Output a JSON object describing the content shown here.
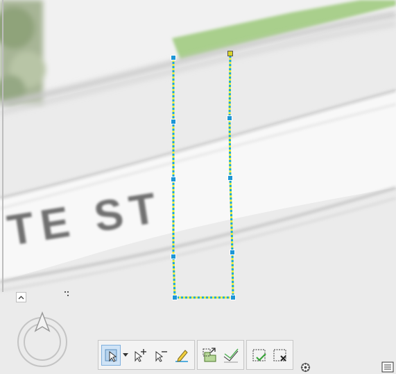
{
  "map": {
    "street_label": "TE ST",
    "colors": {
      "road": "#f6f6f6",
      "ground": "#e9e9e9",
      "grass": "#9cc77b",
      "sketch_line": "#e8ef3a",
      "sketch_dash": "#19a6d6",
      "vertex": "#1f96d6",
      "vertex_selected": "#d8d22a"
    }
  },
  "controls": {
    "collapse_icon": "chevron-up-icon",
    "grip_icon": "grip-icon",
    "navigator_icon": "compass-navigator-icon",
    "settings_icon": "gear-icon",
    "panel_icon": "attribute-panel-icon"
  },
  "editing_toolbar": {
    "groups": [
      {
        "name": "selection",
        "tools": [
          "select-vertex-icon",
          "dropdown-arrow-icon",
          "add-vertex-icon",
          "remove-vertex-icon",
          "continue-feature-icon"
        ]
      },
      {
        "name": "geometry",
        "tools": [
          "reshape-icon",
          "split-icon"
        ]
      },
      {
        "name": "finish",
        "tools": [
          "finish-sketch-icon",
          "discard-sketch-icon"
        ]
      }
    ]
  }
}
